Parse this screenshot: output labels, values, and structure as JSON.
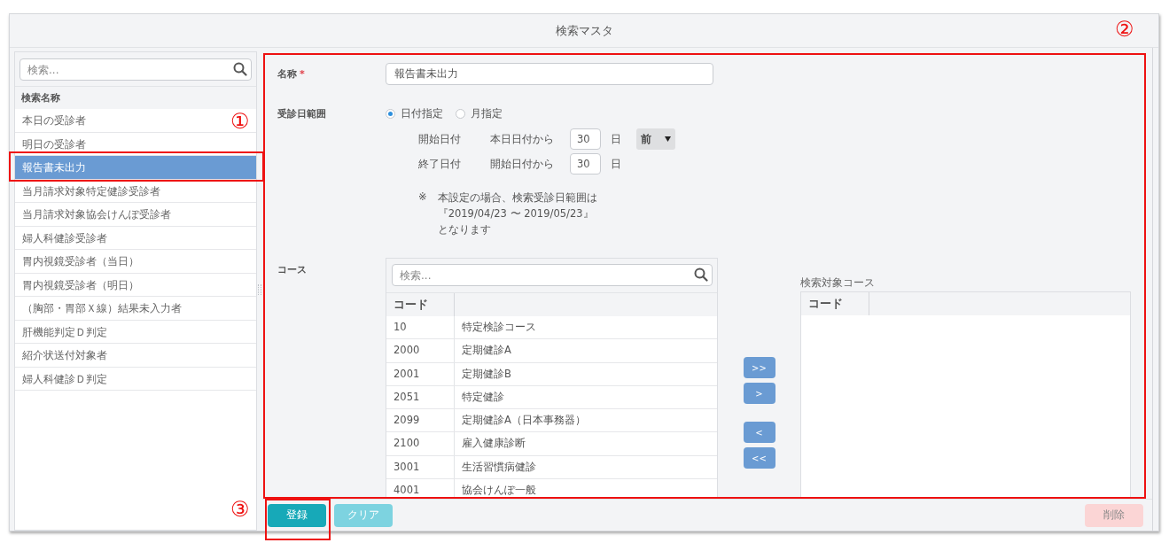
{
  "window": {
    "title": "検索マスタ"
  },
  "sidebar": {
    "search": {
      "placeholder": "検索..."
    },
    "header": "検索名称",
    "items": [
      {
        "label": "本日の受診者",
        "selected": false
      },
      {
        "label": "明日の受診者",
        "selected": false
      },
      {
        "label": "報告書未出力",
        "selected": true
      },
      {
        "label": "当月請求対象特定健診受診者",
        "selected": false
      },
      {
        "label": "当月請求対象協会けんぽ受診者",
        "selected": false
      },
      {
        "label": "婦人科健診受診者",
        "selected": false
      },
      {
        "label": "胃内視鏡受診者（当日）",
        "selected": false
      },
      {
        "label": "胃内視鏡受診者（明日）",
        "selected": false
      },
      {
        "label": "（胸部・胃部Ｘ線）結果未入力者",
        "selected": false
      },
      {
        "label": "肝機能判定Ｄ判定",
        "selected": false
      },
      {
        "label": "紹介状送付対象者",
        "selected": false
      },
      {
        "label": "婦人科健診Ｄ判定",
        "selected": false
      }
    ]
  },
  "form": {
    "name": {
      "label": "名称",
      "required_mark": "*",
      "value": "報告書未出力"
    },
    "date_range": {
      "label": "受診日範囲",
      "options": [
        {
          "label": "日付指定",
          "selected": true
        },
        {
          "label": "月指定",
          "selected": false
        }
      ],
      "start": {
        "label": "開始日付",
        "basis": "本日日付から",
        "value": "30",
        "unit": "日",
        "direction": "前"
      },
      "end": {
        "label": "終了日付",
        "basis": "開始日付から",
        "value": "30",
        "unit": "日"
      },
      "note_mark": "※",
      "note_lines": [
        "本設定の場合、検索受診日範囲は",
        "『2019/04/23 〜 2019/05/23』",
        "となります"
      ]
    },
    "course": {
      "label": "コース",
      "search": {
        "placeholder": "検索..."
      },
      "columns": [
        "コード"
      ],
      "rows": [
        {
          "code": "10",
          "name": "特定検診コース"
        },
        {
          "code": "2000",
          "name": "定期健診A"
        },
        {
          "code": "2001",
          "name": "定期健診B"
        },
        {
          "code": "2051",
          "name": "特定健診"
        },
        {
          "code": "2099",
          "name": "定期健診A（日本事務器）"
        },
        {
          "code": "2100",
          "name": "雇入健康診断"
        },
        {
          "code": "3001",
          "name": "生活習慣病健診"
        },
        {
          "code": "4001",
          "name": "協会けんぽ一般"
        }
      ],
      "transfer_buttons": [
        ">>",
        ">",
        "<",
        "<<"
      ],
      "target": {
        "title": "検索対象コース",
        "columns": [
          "コード"
        ]
      }
    }
  },
  "footer": {
    "buttons": [
      {
        "label": "登録",
        "kind": "primary"
      },
      {
        "label": "クリア",
        "kind": "secondary"
      },
      {
        "label": "削除",
        "kind": "danger"
      }
    ]
  },
  "annotations": [
    {
      "label": "①"
    },
    {
      "label": "②"
    },
    {
      "label": "③"
    }
  ]
}
